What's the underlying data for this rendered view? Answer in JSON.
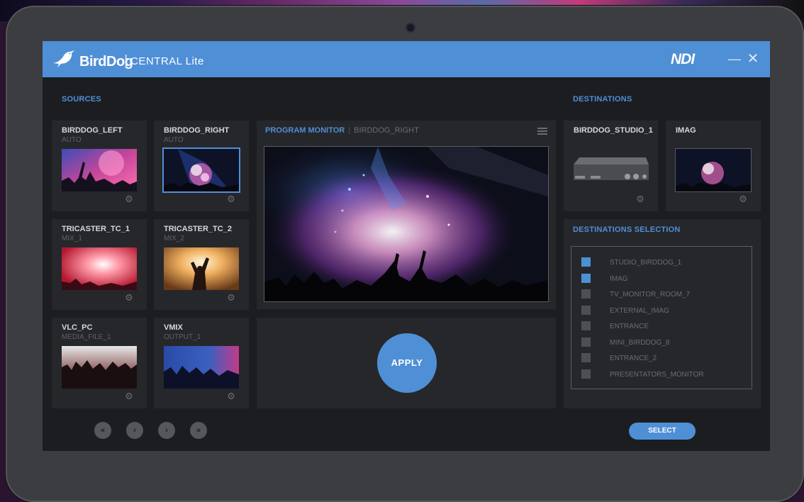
{
  "app": {
    "brand": "BirdDog",
    "separator": "|",
    "product": "CENTRAL Lite",
    "ndi_logo": "NDI",
    "window_controls": {
      "minimize": "—",
      "close": "✕"
    }
  },
  "sources": {
    "title": "SOURCES",
    "items": [
      {
        "name": "BIRDDOG_LEFT",
        "sub": "AUTO",
        "selected": false
      },
      {
        "name": "BIRDDOG_RIGHT",
        "sub": "AUTO",
        "selected": true
      },
      {
        "name": "TRICASTER_TC_1",
        "sub": "MIX_1",
        "selected": false
      },
      {
        "name": "TRICASTER_TC_2",
        "sub": "MIX_2",
        "selected": false
      },
      {
        "name": "VLC_PC",
        "sub": "MEDIA_FILE_1",
        "selected": false
      },
      {
        "name": "VMIX",
        "sub": "OUTPUT_1",
        "selected": false
      }
    ]
  },
  "program_monitor": {
    "label": "PROGRAM MONITOR",
    "separator": "|",
    "source": "BIRDDOG_RIGHT"
  },
  "apply_label": "APPLY",
  "destinations": {
    "title": "DESTINATIONS",
    "items": [
      {
        "name": "BIRDDOG_STUDIO_1"
      },
      {
        "name": "IMAG"
      }
    ]
  },
  "destinations_selection": {
    "title": "DESTINATIONS SELECTION",
    "items": [
      {
        "label": "STUDIO_BIRDDOG_1",
        "checked": true
      },
      {
        "label": "IMAG",
        "checked": true
      },
      {
        "label": "TV_MONITOR_ROOM_7",
        "checked": false
      },
      {
        "label": "EXTERNAL_IMAG",
        "checked": false
      },
      {
        "label": "ENTRANCE",
        "checked": false
      },
      {
        "label": "MINI_BIRDDOG_8",
        "checked": false
      },
      {
        "label": "ENTRANCE_2",
        "checked": false
      },
      {
        "label": "PRESENTATORS_MONITOR",
        "checked": false
      }
    ]
  },
  "pagination": {
    "first": "«",
    "prev": "‹",
    "next": "›",
    "last": "»"
  },
  "select_label": "SELECT",
  "colors": {
    "accent": "#4f8fd6",
    "app_bg": "#1c1d20",
    "panel_bg": "#26272b"
  }
}
